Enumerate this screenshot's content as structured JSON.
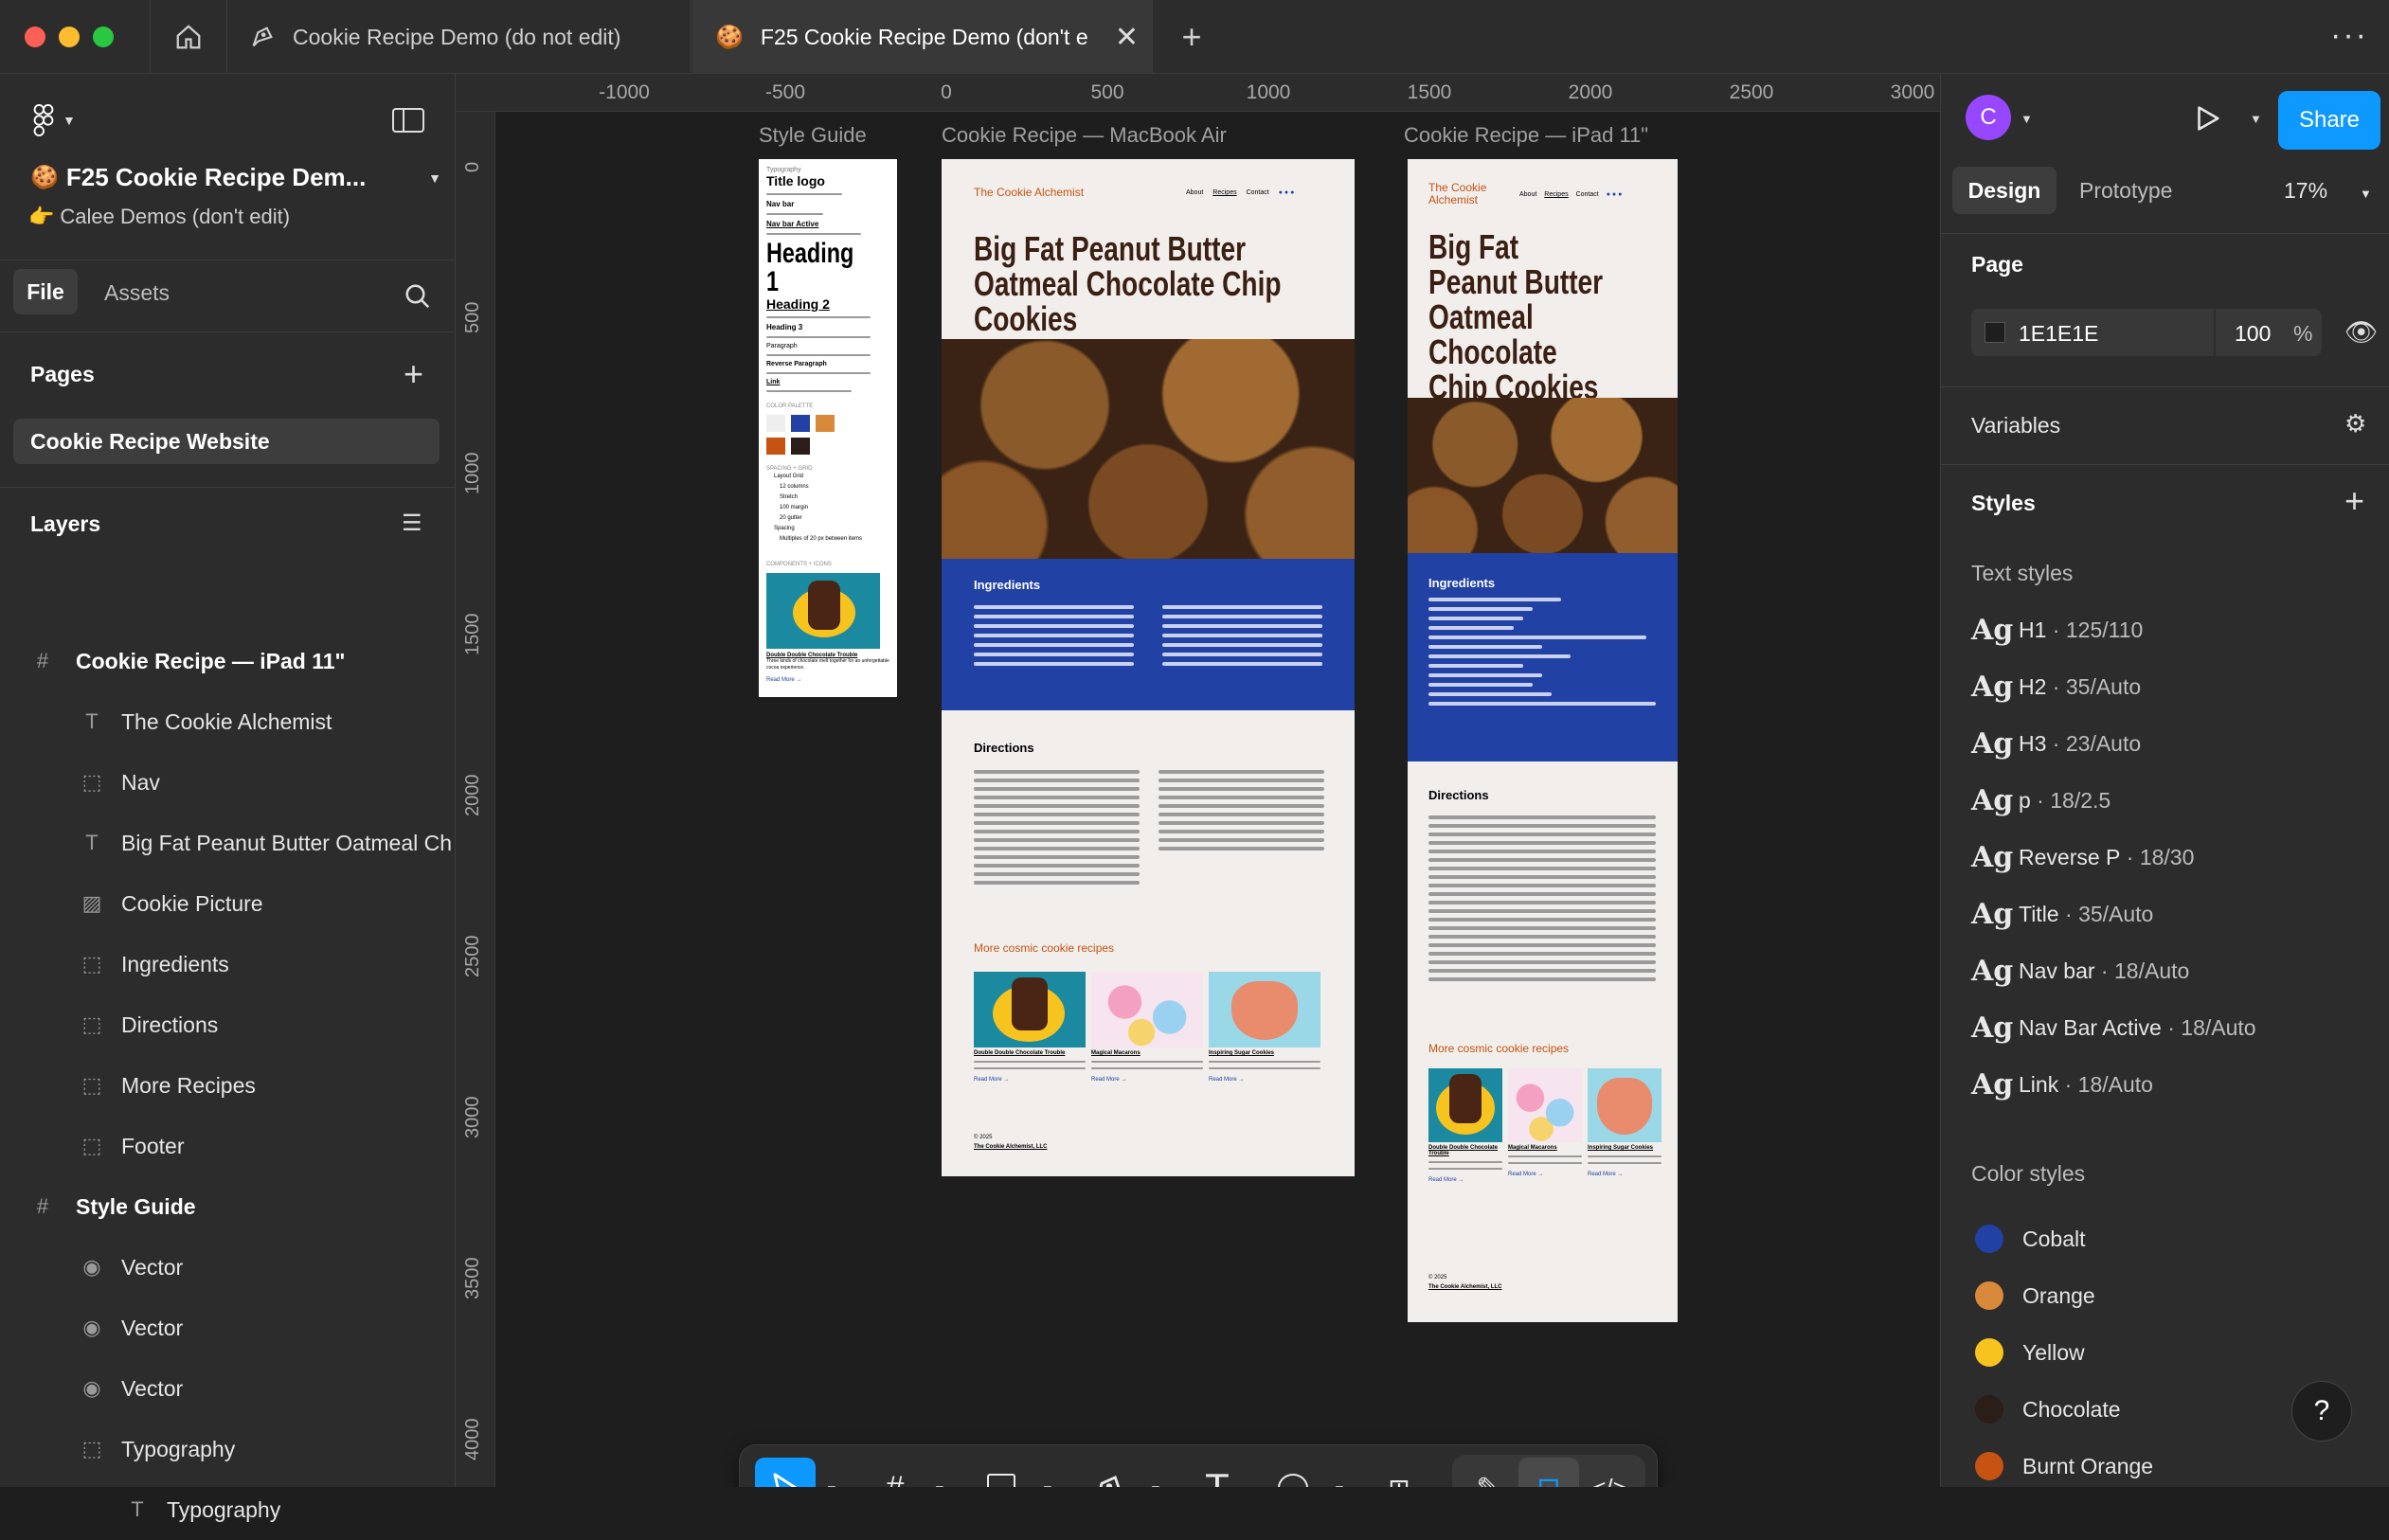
{
  "tabs": [
    {
      "label": "Cookie Recipe Demo (do not edit)"
    },
    {
      "label": "F25 Cookie Recipe Demo (don't e"
    }
  ],
  "file": {
    "title": "F25 Cookie Recipe Dem...",
    "subtitle": "Calee Demos (don't edit)",
    "emoji": "🍪",
    "sub_emoji": "👉"
  },
  "left_tabs": {
    "file": "File",
    "assets": "Assets"
  },
  "pages": {
    "title": "Pages",
    "items": [
      "Cookie Recipe Website"
    ]
  },
  "layers": {
    "title": "Layers",
    "items": [
      {
        "name": "Cookie Recipe — iPad 11\"",
        "icon": "frame-icon",
        "bold": true
      },
      {
        "name": "The Cookie Alchemist",
        "icon": "text-icon"
      },
      {
        "name": "Nav",
        "icon": "group-icon"
      },
      {
        "name": "Big Fat Peanut Butter Oatmeal Ch",
        "icon": "text-icon"
      },
      {
        "name": "Cookie Picture",
        "icon": "image-icon"
      },
      {
        "name": "Ingredients",
        "icon": "group-icon"
      },
      {
        "name": "Directions",
        "icon": "group-icon"
      },
      {
        "name": "More Recipes",
        "icon": "group-icon"
      },
      {
        "name": "Footer",
        "icon": "group-icon"
      },
      {
        "name": "Style Guide",
        "icon": "frame-icon",
        "bold": true
      },
      {
        "name": "Vector",
        "icon": "vector-icon"
      },
      {
        "name": "Vector",
        "icon": "vector-icon"
      },
      {
        "name": "Vector",
        "icon": "vector-icon"
      },
      {
        "name": "Typography",
        "icon": "group-icon"
      },
      {
        "name": "Typography",
        "icon": "text-icon"
      }
    ]
  },
  "ruler": {
    "top": [
      "-1000",
      "-500",
      "0",
      "500",
      "1000",
      "1500",
      "2000",
      "2500",
      "3000"
    ],
    "left": [
      "0",
      "500",
      "1000",
      "1500",
      "2000",
      "2500",
      "3000",
      "3500",
      "4000"
    ]
  },
  "frames": {
    "style_guide": {
      "label": "Style Guide",
      "typography": "Typography",
      "title_logo": "Title logo",
      "nav_bar": "Nav bar",
      "nav_bar_active": "Nav bar Active",
      "heading1": "Heading 1",
      "heading2": "Heading 2",
      "heading3": "Heading 3",
      "paragraph": "Paragraph",
      "reverse": "Reverse Paragraph",
      "link": "Link",
      "color_palette": "COLOR PALETTE",
      "spacing": "SPACING + GRID",
      "spacing_items": [
        "Layout Grid",
        "12 columns",
        "Stretch",
        "100 margin",
        "20 gutter",
        "Spacing",
        "Multiples of 20 px between items"
      ],
      "components": "COMPONENTS + ICONS",
      "card_title": "Double Double Chocolate Trouble",
      "card_text": "Three kinds of chocolate melt together for an unforgettable cocoa experience.",
      "read_more": "Read More →"
    },
    "macbook": {
      "label": "Cookie Recipe — MacBook Air",
      "brand": "The Cookie Alchemist",
      "nav": [
        "About",
        "Recipes",
        "Contact"
      ],
      "headline": "Big Fat Peanut Butter Oatmeal Chocolate Chip Cookies",
      "ingredients": "Ingredients",
      "directions": "Directions",
      "more": "More cosmic cookie recipes",
      "cards": [
        "Double Double Chocolate Trouble",
        "Magical Macarons",
        "Inspiring Sugar Cookies"
      ],
      "read_more": "Read More →",
      "copyright": "© 2025",
      "footer_brand": "The Cookie Alchemist, LLC"
    },
    "ipad": {
      "label": "Cookie Recipe — iPad 11\"",
      "brand": "The Cookie Alchemist",
      "nav": [
        "About",
        "Recipes",
        "Contact"
      ],
      "headline": "Big Fat Peanut Butter Oatmeal Chocolate Chip Cookies",
      "ingredients": "Ingredients",
      "directions": "Directions",
      "more": "More cosmic cookie recipes",
      "cards": [
        "Double Double Chocolate Trouble",
        "Magical Macarons",
        "Inspiring Sugar Cookies"
      ],
      "read_more": "Read More →",
      "copyright": "© 2025",
      "footer_brand": "The Cookie Alchemist, LLC"
    }
  },
  "right": {
    "avatar": "C",
    "share": "Share",
    "tabs": {
      "design": "Design",
      "prototype": "Prototype"
    },
    "zoom": "17%",
    "page_title": "Page",
    "page_color": "1E1E1E",
    "opacity": "100",
    "pct": "%",
    "variables": "Variables",
    "styles": "Styles",
    "text_styles_title": "Text styles",
    "text_styles": [
      {
        "name": "H1",
        "meta": "125/110"
      },
      {
        "name": "H2",
        "meta": "35/Auto"
      },
      {
        "name": "H3",
        "meta": "23/Auto"
      },
      {
        "name": "p",
        "meta": "18/2.5"
      },
      {
        "name": "Reverse P",
        "meta": "18/30"
      },
      {
        "name": "Title",
        "meta": "35/Auto"
      },
      {
        "name": "Nav bar",
        "meta": "18/Auto"
      },
      {
        "name": "Nav Bar Active",
        "meta": "18/Auto"
      },
      {
        "name": "Link",
        "meta": "18/Auto"
      }
    ],
    "color_styles_title": "Color styles",
    "color_styles": [
      {
        "name": "Cobalt",
        "color": "#2141a5"
      },
      {
        "name": "Orange",
        "color": "#d88a3a"
      },
      {
        "name": "Yellow",
        "color": "#f7c31f"
      },
      {
        "name": "Chocolate",
        "color": "#2b1d17"
      },
      {
        "name": "Burnt Orange",
        "color": "#c65311"
      }
    ],
    "ag": "Ag",
    "help": "?"
  },
  "colors": {
    "accent": "#0d99ff",
    "brand_orange": "#c65311",
    "cobalt": "#2141a5"
  }
}
